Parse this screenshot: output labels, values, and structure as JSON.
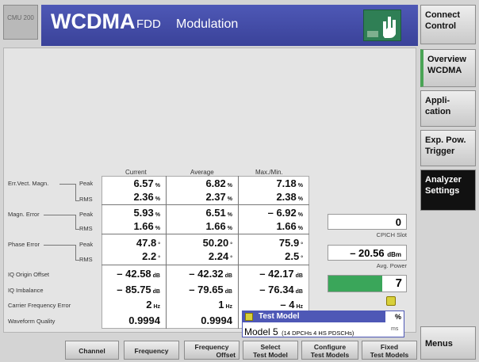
{
  "header": {
    "logo_text": "CMU 200",
    "title": "WCDMA",
    "subtitle1": "FDD",
    "subtitle2": "Modulation"
  },
  "table": {
    "col_current": "Current",
    "col_average": "Average",
    "col_max": "Max./Min.",
    "rows": [
      {
        "label": "Err.Vect. Magn.",
        "sub": "Peak",
        "cur": "6.57",
        "avg": "6.82",
        "max": "7.18",
        "unit": "%"
      },
      {
        "label": "",
        "sub": "RMS",
        "cur": "2.36",
        "avg": "2.37",
        "max": "2.38",
        "unit": "%"
      },
      {
        "label": "Magn. Error",
        "sub": "Peak",
        "cur": "5.93",
        "avg": "6.51",
        "max": "– 6.92",
        "unit": "%"
      },
      {
        "label": "",
        "sub": "RMS",
        "cur": "1.66",
        "avg": "1.66",
        "max": "1.66",
        "unit": "%"
      },
      {
        "label": "Phase Error",
        "sub": "Peak",
        "cur": "47.8",
        "avg": "50.20",
        "max": "75.9",
        "unit": "°"
      },
      {
        "label": "",
        "sub": "RMS",
        "cur": "2.2",
        "avg": "2.24",
        "max": "2.5",
        "unit": "°"
      },
      {
        "label": "IQ Origin Offset",
        "sub": "",
        "cur": "– 42.58",
        "avg": "– 42.32",
        "max": "– 42.17",
        "unit": "dB"
      },
      {
        "label": "IQ Imbalance",
        "sub": "",
        "cur": "– 85.75",
        "avg": "– 79.65",
        "max": "– 76.34",
        "unit": "dB"
      },
      {
        "label": "Carrier Frequency Error",
        "sub": "",
        "cur": "2",
        "avg": "1",
        "max": "– 4",
        "unit": "Hz"
      },
      {
        "label": "Waveform Quality",
        "sub": "",
        "cur": "0.9994",
        "avg": "0.9994",
        "max": "",
        "unit": ""
      }
    ]
  },
  "side": {
    "cpich_value": "0",
    "cpich_label": "CPICH Slot",
    "avg_power_value": "– 20.56",
    "avg_power_unit": "dBm",
    "avg_power_label": "Avg. Power",
    "counter_value": "7",
    "popup_title": "Test Model",
    "popup_model": "Model 5",
    "popup_desc": "(14 DPCHs 4 HS PDSCHs)",
    "popup_cut": "%",
    "popup_cut2": "ms"
  },
  "right_keys": {
    "connect": "Connect Control",
    "overview": "Overview WCDMA",
    "application": "Appli- cation",
    "exp_pow": "Exp. Pow. Trigger",
    "analyzer": "Analyzer Settings",
    "menus": "Menus"
  },
  "bottom_keys": {
    "channel": "Channel",
    "frequency": "Frequency",
    "freq_offset_1": "Frequency",
    "freq_offset_2": "Offset",
    "select_1": "Select",
    "select_2": "Test Model",
    "configure_1": "Configure",
    "configure_2": "Test Models",
    "fixed_1": "Fixed",
    "fixed_2": "Test Models"
  },
  "colors": {
    "title_bg": "#3f47a3",
    "power_bar": "#3aa65a",
    "analyzer_key": "#111111"
  }
}
